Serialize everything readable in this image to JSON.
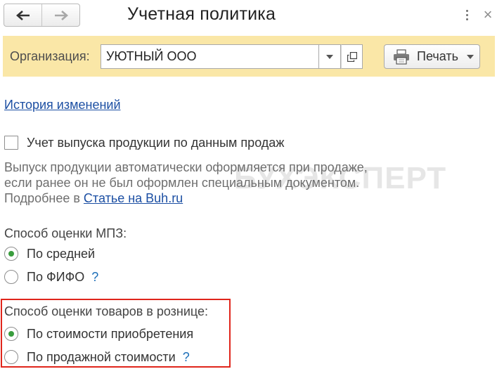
{
  "window": {
    "title": "Учетная политика",
    "back_icon": "arrow-left-icon",
    "forward_icon": "arrow-right-icon",
    "more_icon": "kebab-menu-icon",
    "close_icon": "close-icon",
    "close_glyph": "×"
  },
  "toolbar": {
    "background": "#fae7a7",
    "org_label": "Организация:",
    "org_value": "УЮТНЫЙ ООО",
    "print_label": "Печать"
  },
  "content": {
    "history_link": "История изменений",
    "checkbox_label": "Учет выпуска продукции по данным продаж",
    "checkbox_checked": false,
    "note_line1": "Выпуск продукции автоматически оформляется при продаже,",
    "note_line2": "если ранее он не был оформлен специальным документом.",
    "note_line3_prefix": "Подробнее в ",
    "note_line3_link": "Статье на Buh.ru",
    "watermark": "БУХЭКСПЕРТ"
  },
  "mpz": {
    "label": "Способ оценки МПЗ:",
    "options": [
      {
        "label": "По средней",
        "selected": true
      },
      {
        "label": "По ФИФО",
        "selected": false,
        "help": "?"
      }
    ]
  },
  "retail": {
    "label": "Способ оценки товаров в рознице:",
    "options": [
      {
        "label": "По стоимости приобретения",
        "selected": true
      },
      {
        "label": "По продажной стоимости",
        "selected": false,
        "help": "?"
      }
    ],
    "highlight_color": "#e0251b"
  },
  "colors": {
    "link": "#1c4fa3",
    "radio_selected": "#3a9d3e",
    "help": "#1c6fb8"
  }
}
